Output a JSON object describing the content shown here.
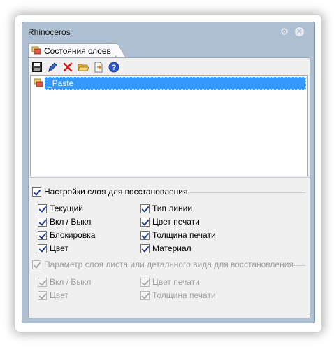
{
  "window": {
    "title": "Rhinoceros"
  },
  "tab": {
    "label": "Состояния слоев"
  },
  "toolbar": [
    {
      "name": "save-icon"
    },
    {
      "name": "edit-icon"
    },
    {
      "name": "delete-icon"
    },
    {
      "name": "open-folder-icon"
    },
    {
      "name": "import-icon"
    },
    {
      "name": "help-icon"
    }
  ],
  "list": {
    "items": [
      {
        "label": "_Paste",
        "selected": true
      }
    ]
  },
  "restore": {
    "label": "Настройки слоя для восстановления",
    "checked": true,
    "left": [
      {
        "label": "Текущий",
        "checked": true
      },
      {
        "label": "Вкл / Выкл",
        "checked": true
      },
      {
        "label": "Блокировка",
        "checked": true
      },
      {
        "label": "Цвет",
        "checked": true
      }
    ],
    "right": [
      {
        "label": "Тип линии",
        "checked": true
      },
      {
        "label": "Цвет печати",
        "checked": true
      },
      {
        "label": "Толщина печати",
        "checked": true
      },
      {
        "label": "Материал",
        "checked": true
      }
    ]
  },
  "detail": {
    "label": "Параметр слоя листа или детального вида для восстановления",
    "checked": true,
    "enabled": false,
    "left": [
      {
        "label": "Вкл / Выкл",
        "checked": true
      },
      {
        "label": "Цвет",
        "checked": true
      }
    ],
    "right": [
      {
        "label": "Цвет печати",
        "checked": true
      },
      {
        "label": "Толщина печати",
        "checked": true
      }
    ]
  },
  "colors": {
    "selection": "#3399ff",
    "frame": "#aebfd2"
  }
}
